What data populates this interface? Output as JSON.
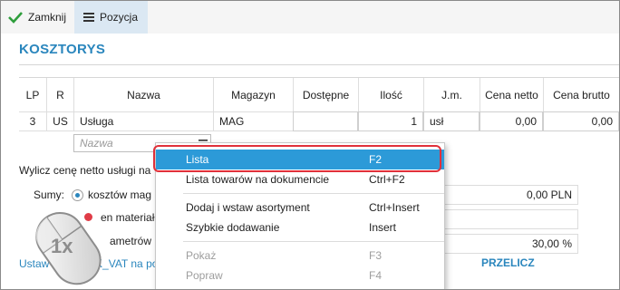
{
  "toolbar": {
    "close_label": "Zamknij",
    "position_label": "Pozycja"
  },
  "title": "KOSZTORYS",
  "grid": {
    "headers": [
      "LP",
      "R",
      "Nazwa",
      "Magazyn",
      "Dostępne",
      "Ilość",
      "J.m.",
      "Cena netto",
      "Cena brutto"
    ],
    "row": {
      "lp": "3",
      "r": "US",
      "nazwa": "Usługa",
      "magazyn": "MAG",
      "dostepne": "",
      "ilosc": "1",
      "jm": "usł",
      "cena_netto": "0,00",
      "cena_brutto": "0,00"
    },
    "nazwa_placeholder": "Nazwa"
  },
  "section": {
    "wylicz_label": "Wylicz cenę netto usługi na",
    "sumy_label": "Sumy:",
    "option1": "kosztów mag",
    "option2": "en materiałó",
    "option3": "ametrów pozycj",
    "value1": "0,00 PLN",
    "value3": "30,00 %",
    "link_label": "Ustaw grupy JPK_VAT na po",
    "przelicz_label": "PRZELICZ"
  },
  "mouse_badge": "1x",
  "context_menu": {
    "items": [
      {
        "label": "Lista",
        "shortcut": "F2"
      },
      {
        "label": "Lista towarów na dokumencie",
        "shortcut": "Ctrl+F2"
      },
      {
        "label": "Dodaj i wstaw asortyment",
        "shortcut": "Ctrl+Insert"
      },
      {
        "label": "Szybkie dodawanie",
        "shortcut": "Insert"
      },
      {
        "label": "Pokaż",
        "shortcut": "F3"
      },
      {
        "label": "Popraw",
        "shortcut": "F4"
      }
    ]
  },
  "colors": {
    "accent": "#2a86bd",
    "menu_selected": "#2c9ad8",
    "highlight": "#e0303a"
  }
}
